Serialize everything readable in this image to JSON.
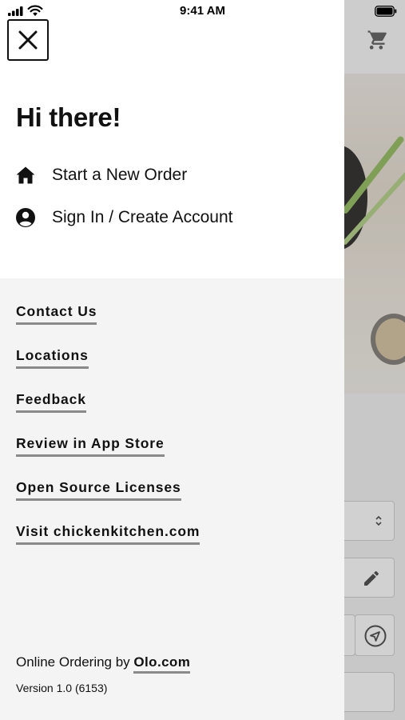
{
  "status_bar": {
    "time": "9:41 AM"
  },
  "greeting": "Hi there!",
  "menu": [
    {
      "icon": "home-icon",
      "label": "Start a New Order"
    },
    {
      "icon": "account-icon",
      "label": "Sign In / Create Account"
    }
  ],
  "links": [
    "Contact Us",
    "Locations",
    "Feedback",
    "Review in App Store",
    "Open Source Licenses",
    "Visit chickenkitchen.com"
  ],
  "footer": {
    "online_ordering_prefix": "Online Ordering by",
    "olo_link": "Olo.com",
    "version": "Version 1.0 (6153)"
  },
  "background_icons": [
    "cart-icon",
    "sort-chevrons-icon",
    "pencil-icon",
    "location-arrow-icon"
  ],
  "colors": {
    "drawer_bottom": "#f4f4f4",
    "text": "#111111",
    "link_underline": "#8a8a8a"
  }
}
